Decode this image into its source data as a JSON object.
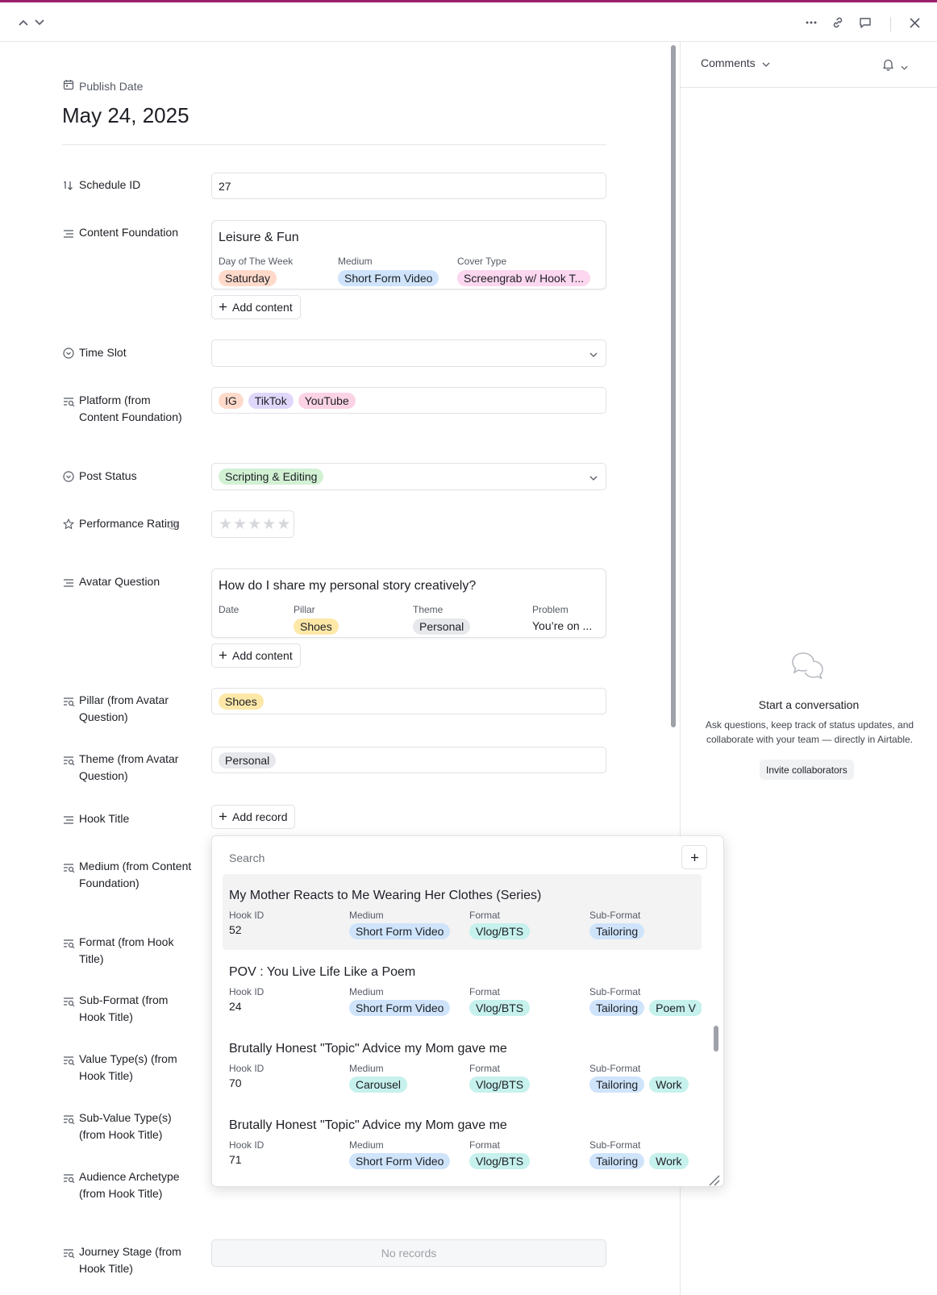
{
  "colors": {
    "accent": "#9c1f6c",
    "pill_orange": "#ffdacb",
    "pill_blue": "#cfe4fb",
    "pill_pink": "#fcd7ef",
    "pill_purple": "#e0d7fb",
    "pill_rose": "#fbd3e4",
    "pill_green": "#d2f1d3",
    "pill_yellow": "#fde8a8",
    "pill_gray": "#e6e8ec",
    "pill_teal": "#c6f1ec"
  },
  "record": {
    "publish_date_label": "Publish Date",
    "publish_date_value": "May 24, 2025"
  },
  "fields": {
    "schedule_id": {
      "label": "Schedule ID",
      "value": "27"
    },
    "content_foundation": {
      "label": "Content Foundation",
      "card_title": "Leisure & Fun",
      "day_label": "Day of The Week",
      "day_value": "Saturday",
      "medium_label": "Medium",
      "medium_value": "Short Form Video",
      "cover_label": "Cover Type",
      "cover_value": "Screengrab w/ Hook T...",
      "add_label": "Add content"
    },
    "time_slot": {
      "label": "Time Slot",
      "value": ""
    },
    "platform": {
      "label": "Platform (from Content Foundation)",
      "values": [
        "IG",
        "TikTok",
        "YouTube"
      ]
    },
    "post_status": {
      "label": "Post Status",
      "value": "Scripting & Editing"
    },
    "performance_rating": {
      "label": "Performance Rating",
      "stars": 0,
      "max": 5
    },
    "avatar_question": {
      "label": "Avatar Question",
      "card_title": "How do I share my personal story creatively?",
      "date_label": "Date",
      "pillar_label": "Pillar",
      "pillar_value": "Shoes",
      "theme_label": "Theme",
      "theme_value": "Personal",
      "problem_label": "Problem",
      "problem_value": "You’re on ...",
      "add_label": "Add content"
    },
    "pillar_from_avatar": {
      "label": "Pillar (from Avatar Question)",
      "value": "Shoes"
    },
    "theme_from_avatar": {
      "label": "Theme (from Avatar Question)",
      "value": "Personal"
    },
    "hook_title": {
      "label": "Hook Title",
      "add_label": "Add record"
    },
    "medium_from_cf": {
      "label": "Medium (from Content Foundation)"
    },
    "format_from_hook": {
      "label": "Format (from Hook Title)"
    },
    "subformat_from_hook": {
      "label": "Sub-Format (from Hook Title)"
    },
    "value_types": {
      "label": "Value Type(s) (from Hook Title)"
    },
    "sub_value_types": {
      "label": "Sub-Value Type(s) (from Hook Title)"
    },
    "audience_archetype": {
      "label": "Audience Archetype (from Hook Title)"
    },
    "journey_stage": {
      "label": "Journey Stage (from Hook Title)",
      "empty_text": "No records"
    }
  },
  "comments": {
    "header": "Comments",
    "empty_title": "Start a conversation",
    "empty_desc": "Ask questions, keep track of status updates, and collaborate with your team — directly in Airtable.",
    "invite_label": "Invite collaborators"
  },
  "picker": {
    "search_placeholder": "Search",
    "col_hook_id": "Hook ID",
    "col_medium": "Medium",
    "col_format": "Format",
    "col_subformat": "Sub-Format",
    "items": [
      {
        "title": "My Mother Reacts to Me Wearing Her Clothes (Series)",
        "hook_id": "52",
        "medium": "Short Form Video",
        "format": "Vlog/BTS",
        "subformats": [
          "Tailoring"
        ]
      },
      {
        "title": "POV : You Live Life Like a Poem",
        "hook_id": "24",
        "medium": "Short Form Video",
        "format": "Vlog/BTS",
        "subformats": [
          "Tailoring",
          "Poem V"
        ]
      },
      {
        "title": "Brutally Honest \"Topic\" Advice my Mom gave me",
        "hook_id": "70",
        "medium": "Carousel",
        "format": "Vlog/BTS",
        "subformats": [
          "Tailoring",
          "Work"
        ]
      },
      {
        "title": "Brutally Honest \"Topic\" Advice my Mom gave me",
        "hook_id": "71",
        "medium": "Short Form Video",
        "format": "Vlog/BTS",
        "subformats": [
          "Tailoring",
          "Work"
        ]
      }
    ]
  }
}
